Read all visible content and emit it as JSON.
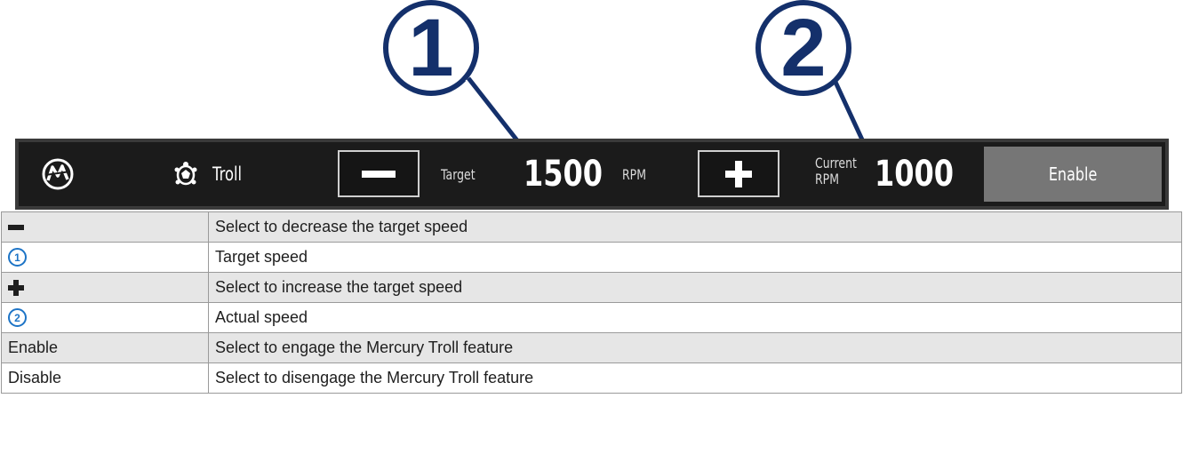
{
  "callouts": [
    {
      "number": "1"
    },
    {
      "number": "2"
    }
  ],
  "toolbar": {
    "mode_label": "Troll",
    "target_label": "Target",
    "target_value": "1500",
    "target_unit": "RPM",
    "current_label_line1": "Current",
    "current_label_line2": "RPM",
    "current_value": "1000",
    "enable_label": "Enable",
    "icons": [
      "mercury-logo",
      "turtle-icon",
      "minus-icon",
      "plus-icon"
    ]
  },
  "legend": {
    "rows": [
      {
        "icon": "minus-icon",
        "description": "Select to decrease the target speed"
      },
      {
        "icon": "callout-1",
        "badge": "1",
        "description": "Target speed"
      },
      {
        "icon": "plus-icon",
        "description": "Select to increase the target speed"
      },
      {
        "icon": "callout-2",
        "badge": "2",
        "description": "Actual speed"
      },
      {
        "term": "Enable",
        "description": "Select to engage the Mercury Troll feature"
      },
      {
        "term": "Disable",
        "description": "Select to disengage the Mercury Troll feature"
      }
    ]
  },
  "colors": {
    "callout": "#14306b",
    "badge": "#1d74c6",
    "toolbar_bg": "#1b1b1b",
    "enable_bg": "#767676",
    "row_shade": "#e6e6e6"
  }
}
